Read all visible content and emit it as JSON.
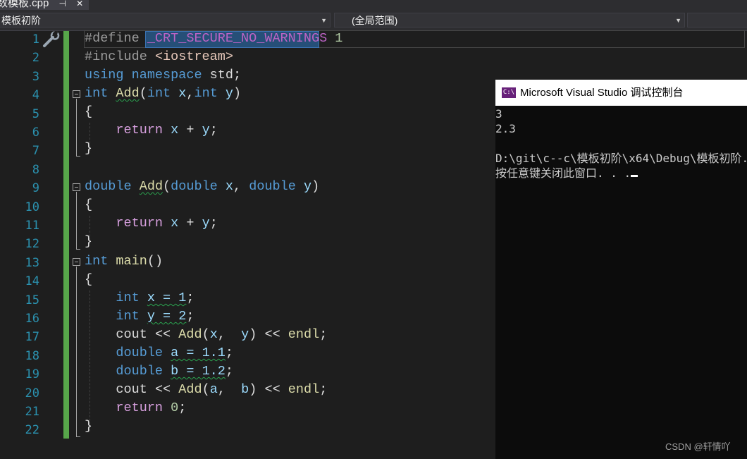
{
  "tab": {
    "filename": "数模板.cpp",
    "pin_glyph": "⊣",
    "close_glyph": "✕"
  },
  "navbar": {
    "project": "模板初阶",
    "scope": "(全局范围)",
    "members": ""
  },
  "editor": {
    "line_numbers": [
      "1",
      "2",
      "3",
      "4",
      "5",
      "6",
      "7",
      "8",
      "9",
      "10",
      "11",
      "12",
      "13",
      "14",
      "15",
      "16",
      "17",
      "18",
      "19",
      "20",
      "21",
      "22"
    ]
  },
  "code": {
    "l1": {
      "directive": "#define",
      "macro": "_CRT_SECURE_NO_WARNINGS",
      "value": "1"
    },
    "l2": {
      "directive": "#include",
      "header": "<iostream>"
    },
    "l3": {
      "using": "using",
      "namespace": "namespace",
      "name": "std",
      "semi": ";"
    },
    "l4": {
      "type": "int",
      "fn": "Add",
      "open": "(",
      "t1": "int",
      "p1": "x",
      "comma": ",",
      "t2": "int",
      "p2": "y",
      "close": ")"
    },
    "l5": "{",
    "l6": {
      "ret": "return",
      "expr1": "x",
      "op": "+",
      "expr2": "y",
      "semi": ";"
    },
    "l7": "}",
    "l9": {
      "type": "double",
      "fn": "Add",
      "open": "(",
      "t1": "double",
      "p1": "x",
      "comma": ",",
      "t2": "double",
      "p2": "y",
      "close": ")"
    },
    "l10": "{",
    "l11": {
      "ret": "return",
      "expr1": "x",
      "op": "+",
      "expr2": "y",
      "semi": ";"
    },
    "l12": "}",
    "l13": {
      "type": "int",
      "fn": "main",
      "parens": "()"
    },
    "l14": "{",
    "l15": {
      "type": "int",
      "decl": "x = 1",
      "semi": ";"
    },
    "l16": {
      "type": "int",
      "decl": "y = 2",
      "semi": ";"
    },
    "l17": {
      "cout": "cout",
      "op1": "<<",
      "fn": "Add",
      "open": "(",
      "a1": "x",
      "comma": ",",
      "a2": "y",
      "close": ")",
      "op2": "<<",
      "endl": "endl",
      "semi": ";"
    },
    "l18": {
      "type": "double",
      "decl": "a = 1.1",
      "semi": ";"
    },
    "l19": {
      "type": "double",
      "decl": "b = 1.2",
      "semi": ";"
    },
    "l20": {
      "cout": "cout",
      "op1": "<<",
      "fn": "Add",
      "open": "(",
      "a1": "a",
      "comma": ",",
      "a2": "b",
      "close": ")",
      "op2": "<<",
      "endl": "endl",
      "semi": ";"
    },
    "l21": {
      "ret": "return",
      "val": "0",
      "semi": ";"
    },
    "l22": "}"
  },
  "console": {
    "icon": "C:\\",
    "title": "Microsoft Visual Studio 调试控制台",
    "lines": [
      "3",
      "2.3",
      "",
      "D:\\git\\c--c\\模板初阶\\x64\\Debug\\模板初阶.exe",
      "按任意键关闭此窗口. . ."
    ]
  },
  "watermark": "CSDN @轩情吖",
  "colors": {
    "keyword": "#569cd6",
    "control": "#d8a0df",
    "function": "#dcdcaa",
    "macro": "#bd63c5",
    "line_number": "#2b91af",
    "change_bar": "#57a64a",
    "console_icon": "#68217a"
  }
}
